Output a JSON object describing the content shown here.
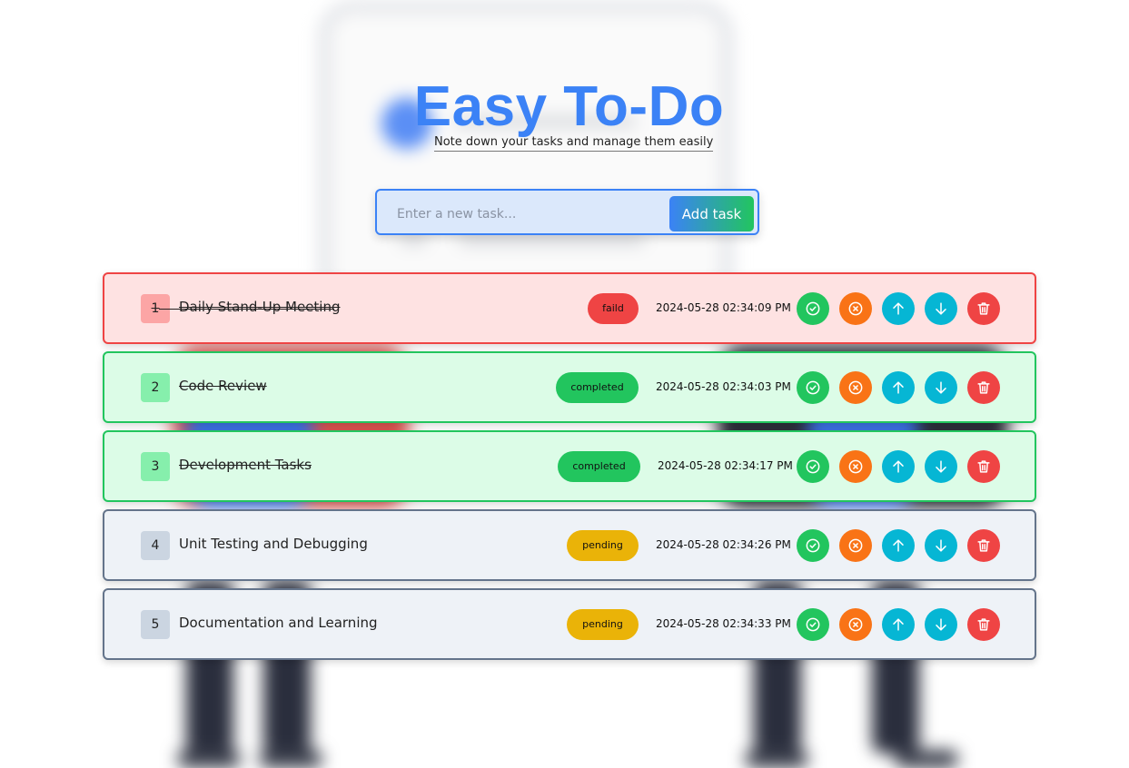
{
  "header": {
    "title": "Easy To-Do",
    "subtitle": "Note down your tasks and manage them easily"
  },
  "input": {
    "placeholder": "Enter a new task...",
    "add_label": "Add task"
  },
  "tasks": [
    {
      "number": "1",
      "title": "Daily Stand-Up Meeting",
      "status": "faild",
      "timestamp": "2024-05-28 02:34:09 PM"
    },
    {
      "number": "2",
      "title": "Code Review",
      "status": "completed",
      "timestamp": "2024-05-28 02:34:03 PM"
    },
    {
      "number": "3",
      "title": "Development Tasks",
      "status": "completed",
      "timestamp": "2024-05-28 02:34:17 PM"
    },
    {
      "number": "4",
      "title": "Unit Testing and Debugging",
      "status": "pending",
      "timestamp": "2024-05-28 02:34:26 PM"
    },
    {
      "number": "5",
      "title": "Documentation and Learning",
      "status": "pending",
      "timestamp": "2024-05-28 02:34:33 PM"
    }
  ],
  "colors": {
    "accent": "#3b82f6",
    "failed": "#ef4444",
    "completed": "#22c55e",
    "pending": "#eab308",
    "cancel": "#f97316",
    "move": "#06b6d4"
  },
  "icons": {
    "check": "check-circle-icon",
    "cancel": "x-circle-icon",
    "up": "arrow-up-icon",
    "down": "arrow-down-icon",
    "delete": "trash-icon"
  }
}
